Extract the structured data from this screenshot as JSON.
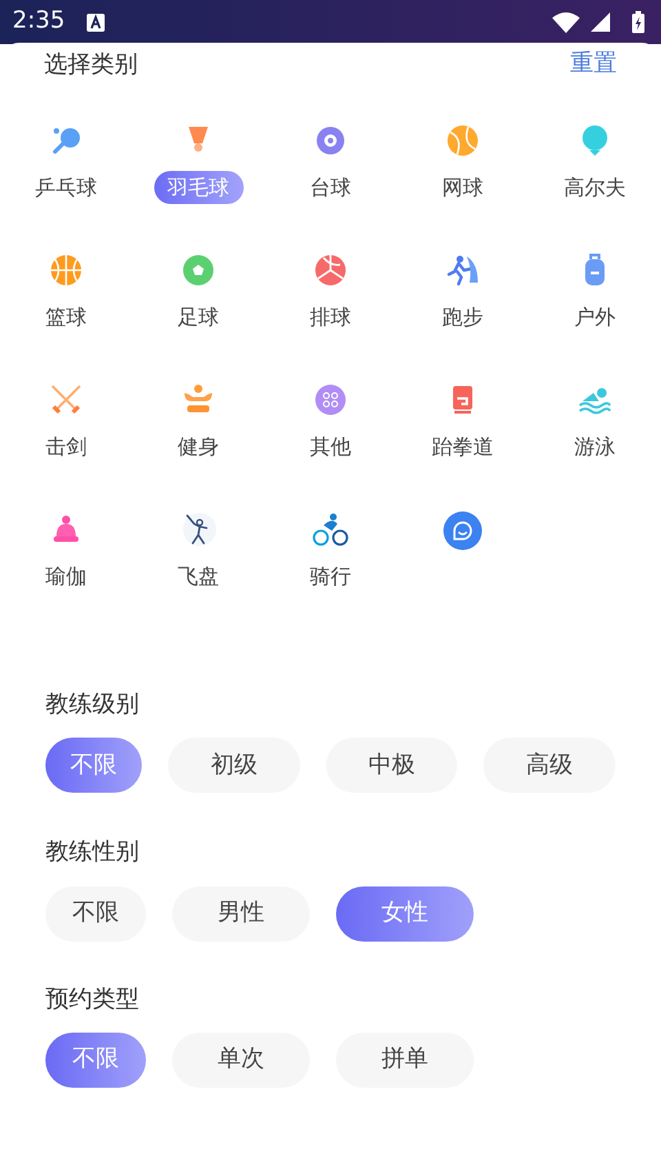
{
  "status_bar": {
    "time": "2:35"
  },
  "header": {
    "title": "选择类别",
    "reset": "重置"
  },
  "categories": [
    {
      "label": "乒乓球",
      "selected": false
    },
    {
      "label": "羽毛球",
      "selected": true
    },
    {
      "label": "台球",
      "selected": false
    },
    {
      "label": "网球",
      "selected": false
    },
    {
      "label": "高尔夫",
      "selected": false
    },
    {
      "label": "篮球",
      "selected": false
    },
    {
      "label": "足球",
      "selected": false
    },
    {
      "label": "排球",
      "selected": false
    },
    {
      "label": "跑步",
      "selected": false
    },
    {
      "label": "户外",
      "selected": false
    },
    {
      "label": "击剑",
      "selected": false
    },
    {
      "label": "健身",
      "selected": false
    },
    {
      "label": "其他",
      "selected": false
    },
    {
      "label": "跆拳道",
      "selected": false
    },
    {
      "label": "游泳",
      "selected": false
    },
    {
      "label": "瑜伽",
      "selected": false
    },
    {
      "label": "飞盘",
      "selected": false
    },
    {
      "label": "骑行",
      "selected": false
    },
    {
      "selected": false
    }
  ],
  "filters": [
    {
      "title": "教练级别",
      "options": [
        {
          "label": "不限",
          "selected": true
        },
        {
          "label": "初级",
          "selected": false
        },
        {
          "label": "中极",
          "selected": false
        },
        {
          "label": "高级",
          "selected": false
        }
      ]
    },
    {
      "title": "教练性别",
      "options": [
        {
          "label": "不限",
          "selected": false
        },
        {
          "label": "男性",
          "selected": false
        },
        {
          "label": "女性",
          "selected": true
        }
      ]
    },
    {
      "title": "预约类型",
      "options": [
        {
          "label": "不限",
          "selected": true
        },
        {
          "label": "单次",
          "selected": false
        },
        {
          "label": "拼单",
          "selected": false
        }
      ]
    }
  ]
}
